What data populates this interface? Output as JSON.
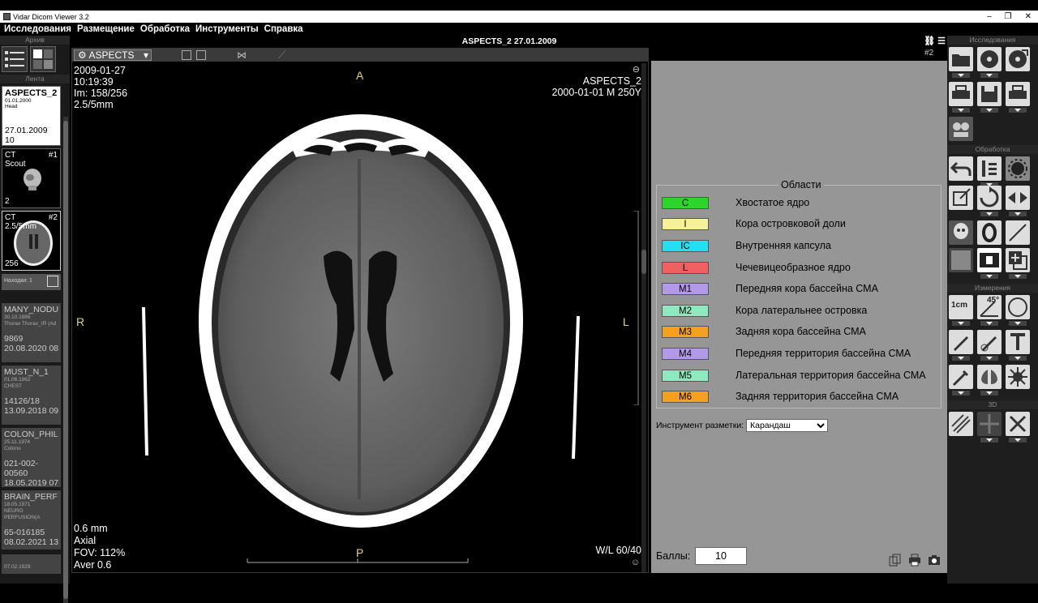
{
  "window": {
    "title": "Vidar Dicom Viewer 3.2"
  },
  "menu": [
    "Исследования",
    "Размещение",
    "Обработка",
    "Инструменты",
    "Справка"
  ],
  "study_header": "ASPECTS_2  27.01.2009",
  "page_indicator": "#2",
  "left": {
    "archive_label": "Архив",
    "tape_label": "Лента",
    "current_study": {
      "name": "ASPECTS_2",
      "dob": "01.01.2000",
      "body": "Head",
      "date": "27.01.2009 10"
    },
    "series": [
      {
        "modality": "CT",
        "desc": "Scout",
        "num": "#1",
        "count": "2"
      },
      {
        "modality": "CT",
        "desc": "2.5/5mm",
        "num": "#2",
        "count": "256"
      }
    ],
    "findings_label": "Находки: 1",
    "studies": [
      {
        "name": "MANY_NODU",
        "dob": "30.10.1986",
        "desc": "Thorax Thorax_IR (Ad",
        "id": "9869",
        "date": "20.08.2020 08"
      },
      {
        "name": "MUST_N_1",
        "dob": "01.06.1962",
        "desc": "CHEST",
        "id": "14126/18",
        "date": "13.09.2018 09"
      },
      {
        "name": "COLON_PHIL",
        "dob": "25.11.1974",
        "desc": "Colono",
        "id": "021-002-00560",
        "date": "18.05.2019 07"
      },
      {
        "name": "BRAIN_PERF",
        "dob": "18.05.1971",
        "desc": "NEURO PERFUSION(A",
        "id": "65-016185",
        "date": "08.02.2021 13"
      },
      {
        "name": "",
        "dob": "07.02.1929",
        "desc": "",
        "id": "",
        "date": ""
      }
    ]
  },
  "viewer": {
    "preset": "ASPECTS",
    "date": "2009-01-27",
    "time": "10:19:39",
    "image": "Im: 158/256",
    "thickness": "2.5/5mm",
    "patient": "ASPECTS_2",
    "patient_info": "2000-01-01 M   250Y",
    "slice": "0.6 mm",
    "plane": "Axial",
    "fov": "FOV: 112%",
    "aver": "Aver 0.6",
    "wl": "W/L 60/40",
    "orient": {
      "top": "A",
      "bottom": "P",
      "left": "R",
      "right": "L"
    }
  },
  "aspects": {
    "title": "Области",
    "areas": [
      {
        "code": "C",
        "label": "Хвостатое ядро",
        "color": "#2bd52b"
      },
      {
        "code": "I",
        "label": "Кора островковой доли",
        "color": "#f5f09a"
      },
      {
        "code": "IC",
        "label": "Внутренняя капсула",
        "color": "#22e0f0"
      },
      {
        "code": "L",
        "label": "Чечевицеобразное ядро",
        "color": "#f06060"
      },
      {
        "code": "M1",
        "label": "Передняя кора бассейна СМА",
        "color": "#b39ae8"
      },
      {
        "code": "M2",
        "label": "Кора латеральнее островка",
        "color": "#8ee8c0"
      },
      {
        "code": "M3",
        "label": "Задняя кора бассейна СМА",
        "color": "#f5a020"
      },
      {
        "code": "M4",
        "label": "Передняя территория бассейна СМА",
        "color": "#b39ae8"
      },
      {
        "code": "M5",
        "label": "Латеральная территория бассейна СМА",
        "color": "#8ee8c0"
      },
      {
        "code": "M6",
        "label": "Задняя территория бассейна СМА",
        "color": "#f5a020"
      }
    ],
    "tool_label": "Инструмент разметки:",
    "tool_value": "Карандаш",
    "score_label": "Баллы:",
    "score": "10"
  },
  "tools": {
    "sections": [
      "Исследования",
      "Обработка",
      "Измерения",
      "3D"
    ],
    "ruler_label": "1cm",
    "angle_label": "45°"
  }
}
